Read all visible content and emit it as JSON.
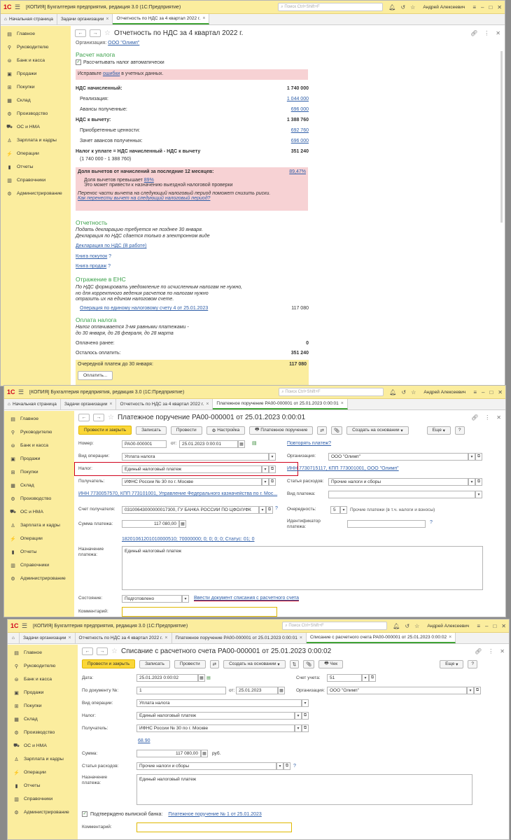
{
  "app": {
    "title": "[КОПИЯ] Бухгалтерия предприятия, редакция 3.0  (1С:Предприятие)",
    "search_placeholder": "Поиск Ctrl+Shift+F",
    "user": "Андрей Алексеевич",
    "logo": "1С"
  },
  "sidebar": [
    "Главное",
    "Руководителю",
    "Банк и касса",
    "Продажи",
    "Покупки",
    "Склад",
    "Производство",
    "ОС и НМА",
    "Зарплата и кадры",
    "Операции",
    "Отчеты",
    "Справочники",
    "Администрирование"
  ],
  "w1": {
    "tabs": [
      "Начальная страница",
      "Задачи организации",
      "Отчетность по НДС за 4 квартал 2022 г."
    ],
    "title": "Отчетность по НДС за 4 квартал 2022 г.",
    "org_label": "Организация:",
    "org_value": "ООО \"Олимп\"",
    "calc_header": "Расчет налога",
    "auto_calc": "Рассчитывать налог автоматически",
    "fix_prefix": "Исправьте ",
    "fix_link": "ошибки",
    "fix_suffix": " в учетных данных.",
    "nds_acc": "НДС начисленный:",
    "nds_acc_val": "1 740 000",
    "sales": "Реализация:",
    "sales_val": "1 044 000",
    "adv": "Авансы полученные:",
    "adv_val": "696 000",
    "nds_ded": "НДС к вычету:",
    "nds_ded_val": "1 388 760",
    "acq": "Приобретенные ценности:",
    "acq_val": "692 760",
    "adv_off": "Зачет авансов полученных:",
    "adv_off_val": "696 000",
    "tax_pay": "Налог к уплате = НДС начисленный - НДС к вычету",
    "tax_pay_val": "351 240",
    "calc_expr": "(1 740 000 - 1 388 760)",
    "share_title": "Доля вычетов от начислений за последние 12 месяцев:",
    "share_val": "89,47%",
    "share_exceeds": "Доля вычетов превышает ",
    "share_link": "89%",
    "share_warn": "Это может привести к назначению выездной налоговой проверки",
    "transfer_note": "Перенос части вычета на следующий налоговый период поможет снизить риски.",
    "transfer_link": "Как перенести вычет на следующий налоговый период?",
    "rep_header": "Отчетность",
    "rep_note1": "Подать декларацию требуется не позднее 30 января.",
    "rep_note2": "Декларация по НДС сдается только в электронном виде",
    "rep_decl": "Декларация по НДС (В работе)",
    "rep_buy": "Книга покупок",
    "rep_sell": "Книга продаж",
    "ens_header": "Отражение в ЕНС",
    "ens_note1": "По НДС формировать уведомление по исчисленным налогам не нужно,",
    "ens_note2": "но для корректного ведения расчетов по налогам нужно",
    "ens_note3": "отразить их на едином налоговом счете.",
    "ens_op": "Операция по единому налоговому счету 4 от 25.01.2023",
    "ens_op_val": "117 080",
    "pay_header": "Оплата налога",
    "pay_note1": "Налог оплачивается 3-мя равными платежами -",
    "pay_note2": "до 30 января, до 28 февраля, до 28 марта",
    "paid": "Оплачено ранее:",
    "paid_val": "0",
    "left": "Осталось оплатить:",
    "left_val": "351 240",
    "next": "Очередной платеж до 30 января:",
    "next_val": "117 080",
    "pay_btn": "Оплатить..."
  },
  "w2": {
    "tabs": [
      "Начальная страница",
      "Задачи организации",
      "Отчетность по НДС за 4 квартал 2022 г.",
      "Платежное поручение РА00-000001 от 25.01.2023 0:00:01"
    ],
    "title": "Платежное поручение РА00-000001 от 25.01.2023 0:00:01",
    "btn_post_close": "Провести и закрыть",
    "btn_save": "Записать",
    "btn_post": "Провести",
    "btn_settings": "Настройка",
    "btn_payorder": "Платежное поручение",
    "btn_create": "Создать на основании",
    "btn_more": "Еще",
    "btn_help": "?",
    "num_label": "Номер:",
    "num_val": "РА00-000001",
    "from": "от:",
    "date_val": "25.01.2023  0:00:01",
    "repeat_link": "Повторять платеж?",
    "op_label": "Вид операции:",
    "op_val": "Уплата налога",
    "org_label": "Организация:",
    "org_val": "ООО \"Олимп\"",
    "tax_label": "Налог:",
    "tax_val": "Единый налоговый платеж",
    "inn_link": "ИНН 7730715117, КПП 773001001, ООО \"Олимп\"",
    "rcp_label": "Получатель:",
    "rcp_val": "ИФНС России № 30 по г. Москве",
    "exp_label": "Статья расходов:",
    "exp_val": "Прочие налоги и сборы",
    "rcp_link": "ИНН 7730057570, КПП 773101001, Управление Федерального казначейства по г. Мос...",
    "pay_type_label": "Вид платежа:",
    "acc_label": "Счет получателя:",
    "acc_val": "03100643000000017300, ГУ БАНКА РОССИИ ПО ЦФО//УФК",
    "queue_label": "Очередность:",
    "queue_val": "5",
    "queue_text": "Прочие платежи (в т.ч. налоги и взносы)",
    "sum_label": "Сумма платежа:",
    "sum_val": "117 080,00",
    "id_label": "Идентификатор платежа:",
    "kbk_link": "18201061201010000510; 70000000; 0; 0; 0; 0; Статус: 01; 0",
    "purpose_label": "Назначение платежа:",
    "purpose_val": "Единый налоговый платеж",
    "state_label": "Состояние:",
    "state_val": "Подготовлено",
    "writeoff_link": "Ввести документ списания с расчетного счета",
    "comment_label": "Комментарий:"
  },
  "w3": {
    "tabs": [
      "Задачи организации",
      "Отчетность по НДС за 4 квартал 2022 г.",
      "Платежное поручение РА00-000001 от 25.01.2023 0:00:01",
      "Списание с расчетного счета РА00-000001 от 25.01.2023 0:00:02"
    ],
    "title": "Списание с расчетного счета РА00-000001 от 25.01.2023 0:00:02",
    "btn_post_close": "Провести и закрыть",
    "btn_save": "Записать",
    "btn_post": "Провести",
    "btn_create": "Создать на основании",
    "btn_check": "Чек",
    "btn_more": "Еще",
    "btn_help": "?",
    "date_label": "Дата:",
    "date_val": "25.01.2023  0:00:02",
    "acc_label": "Счет учета:",
    "acc_val": "51",
    "docnum_label": "По документу №:",
    "docnum_val": "1",
    "from": "от:",
    "docdate_val": "25.01.2023",
    "org_label": "Организация:",
    "org_val": "ООО \"Олимп\"",
    "op_label": "Вид операции:",
    "op_val": "Уплата налога",
    "tax_label": "Налог:",
    "tax_val": "Единый налоговый платеж",
    "rcp_label": "Получатель:",
    "rcp_val": "ИФНС России № 30 по г. Москве",
    "acc2_link": "68.90",
    "sum_label": "Сумма:",
    "sum_val": "117 080,00",
    "rub": "руб.",
    "exp_label": "Статья расходов:",
    "exp_val": "Прочие налоги и сборы",
    "purpose_label": "Назначение платежа:",
    "purpose_val": "Единый налоговый платеж",
    "confirmed": "Подтверждено выпиской банка:",
    "confirmed_link": "Платежное поручение № 1 от 25.01.2023",
    "comment_label": "Комментарий:"
  }
}
